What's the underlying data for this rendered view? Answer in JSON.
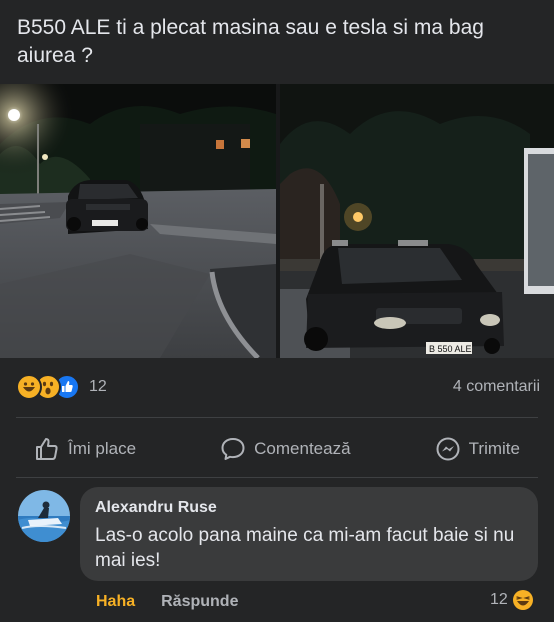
{
  "post": {
    "text": "B550 ALE ti a plecat masina sau e tesla si ma bag aiurea ?",
    "plate": "B 550 ALE"
  },
  "stats": {
    "reactions": [
      "haha",
      "wow",
      "like"
    ],
    "reaction_count": "12",
    "comments_label": "4 comentarii"
  },
  "actions": {
    "like": "Îmi place",
    "comment": "Comentează",
    "share": "Trimite"
  },
  "comment": {
    "author": "Alexandru Ruse",
    "text": "Las-o acolo pana maine ca mi-am facut baie si nu mai ies!",
    "haha_label": "Haha",
    "reply_label": "Răspunde",
    "reaction_count": "12",
    "reaction_icon": "haha"
  },
  "colors": {
    "background": "#242526",
    "bubble": "#3a3b3c",
    "haha": "#f7b125",
    "like": "#1877f2",
    "muted": "#b0b3b8"
  }
}
